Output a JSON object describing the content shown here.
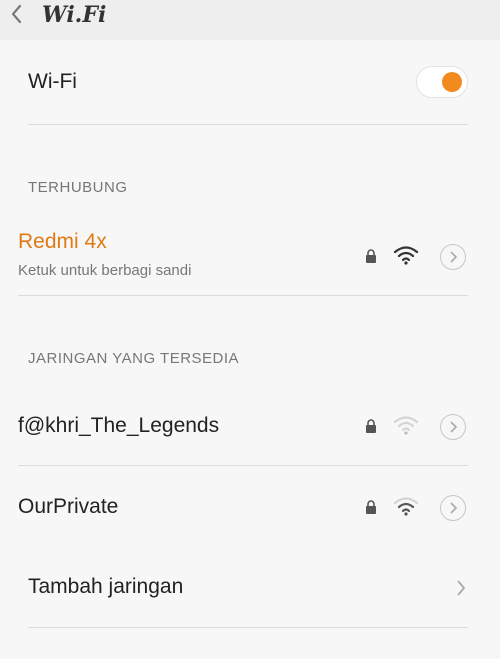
{
  "header": {
    "title": "Wi.Fi"
  },
  "wifi_toggle": {
    "label": "Wi-Fi",
    "enabled": true,
    "accent": "#f28b1e"
  },
  "sections": {
    "connected": "TERHUBUNG",
    "available": "JARINGAN YANG TERSEDIA"
  },
  "connected_network": {
    "name": "Redmi 4x",
    "subtitle": "Ketuk untuk berbagi sandi",
    "color": "#e07a14",
    "locked": true,
    "signal": "strong"
  },
  "available_networks": [
    {
      "name": "f@khri_The_Legends",
      "locked": true,
      "signal": "weak"
    },
    {
      "name": "OurPrivate",
      "locked": true,
      "signal": "medium"
    }
  ],
  "add_network": {
    "label": "Tambah jaringan"
  },
  "icons": {
    "back": "chevron-left-icon",
    "lock": "lock-icon",
    "wifi": "wifi-signal-icon",
    "detail": "chevron-right-circle-icon",
    "chevron": "chevron-right-icon"
  }
}
